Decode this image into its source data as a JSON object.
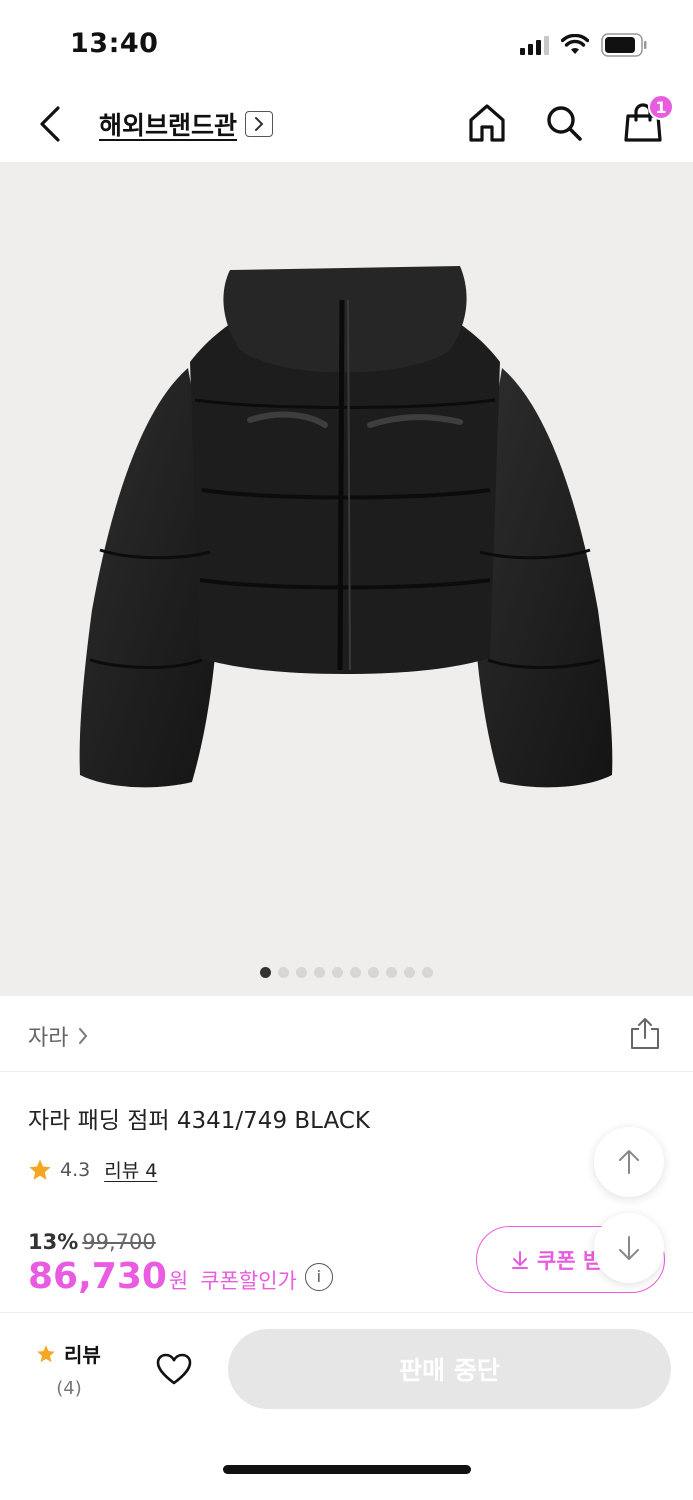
{
  "status_bar": {
    "time": "13:40"
  },
  "nav": {
    "brand_title": "해외브랜드관",
    "cart_count": "1"
  },
  "gallery": {
    "total_images": 10,
    "active_index": 0
  },
  "product": {
    "brand": "자라",
    "title": "자라 패딩 점퍼 4341/749 BLACK",
    "rating": "4.3",
    "review_link": "리뷰 4",
    "discount_rate": "13%",
    "original_price": "99,700",
    "final_price": "86,730",
    "currency": "원",
    "coupon_price_label": "쿠폰할인가",
    "info_glyph": "i"
  },
  "coupon_button": {
    "label": "쿠폰 받"
  },
  "bottom_bar": {
    "review_label": "리뷰",
    "review_count": "(4)",
    "cta_label": "판매 중단"
  },
  "colors": {
    "accent": "#e95ce1",
    "star": "#f5a623",
    "hero_bg": "#efeeec"
  }
}
